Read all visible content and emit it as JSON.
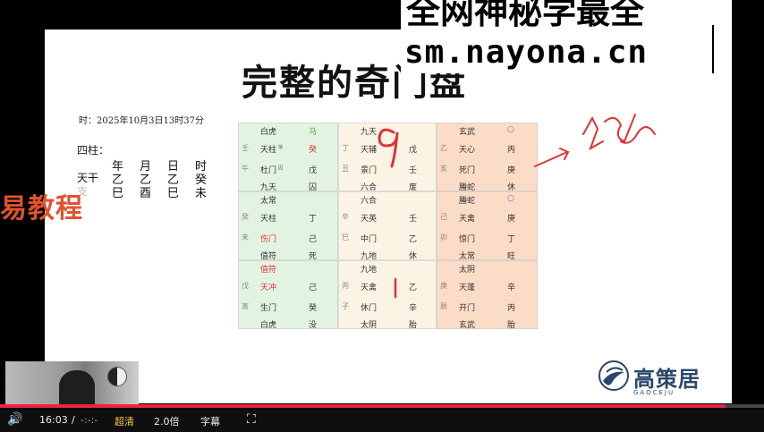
{
  "watermark": {
    "line1": "全网神秘学最全",
    "line2": "sm.nayona.cn"
  },
  "slide": {
    "title": "完整的奇门盘",
    "time_label": "时：2025年10月3日13时37分",
    "sizhu_label": "四柱：",
    "pillar_headers": [
      "年",
      "月",
      "日",
      "时"
    ],
    "tiangan_label": "天干",
    "tiangan": [
      "乙",
      "乙",
      "乙",
      "癸"
    ],
    "dizhi_label": "支",
    "dizhi": [
      "巳",
      "酉",
      "巳",
      "未"
    ]
  },
  "side_label": "易教程",
  "grid": [
    {
      "color": "green",
      "lines": [
        {
          "side": "",
          "a": "白虎",
          "b": "马",
          "b_color": "green"
        },
        {
          "side": "壬",
          "a": "天柱",
          "a_sub": "惊",
          "b": "癸",
          "b_color": "red"
        },
        {
          "side": "午",
          "a": "杜门",
          "a_sub": "囚",
          "b": "戊"
        },
        {
          "side": "",
          "a": "九天",
          "b": "囚"
        }
      ]
    },
    {
      "color": "cream",
      "lines": [
        {
          "side": "",
          "a": "九天"
        },
        {
          "side": "丁",
          "a": "天辅",
          "b": "戊"
        },
        {
          "side": "丑",
          "a": "景门",
          "b": "壬"
        },
        {
          "side": "",
          "a": "六合",
          "b": "废"
        }
      ]
    },
    {
      "color": "orange",
      "lines": [
        {
          "side": "",
          "a": "玄武",
          "b": "○",
          "b_color": "purple"
        },
        {
          "side": "乙",
          "a": "天心",
          "b": "丙"
        },
        {
          "side": "亥",
          "a": "死门",
          "b": "庚"
        },
        {
          "side": "",
          "a": "螣蛇",
          "b": "休"
        }
      ]
    },
    {
      "color": "green",
      "lines": [
        {
          "side": "",
          "a": "太常"
        },
        {
          "side": "癸",
          "a": "天柱",
          "b": "丁"
        },
        {
          "side": "未",
          "a": "伤门",
          "a_color": "red",
          "b": "己"
        },
        {
          "side": "",
          "a": "值符",
          "b": "死"
        }
      ]
    },
    {
      "color": "cream",
      "lines": [
        {
          "side": "",
          "a": "六合"
        },
        {
          "side": "辛",
          "a": "天英",
          "b": "壬"
        },
        {
          "side": "巳",
          "a": "中门",
          "b": "乙"
        },
        {
          "side": "",
          "a": "九地",
          "b": "休"
        }
      ]
    },
    {
      "color": "orange",
      "lines": [
        {
          "side": "",
          "a": "螣蛇",
          "b": "○",
          "b_color": "purple"
        },
        {
          "side": "己",
          "a": "天禽",
          "b": "庚"
        },
        {
          "side": "卯",
          "a": "惊门",
          "b": "丁"
        },
        {
          "side": "",
          "a": "太常",
          "b": "旺"
        }
      ]
    },
    {
      "color": "green",
      "lines": [
        {
          "side": "",
          "a": "值符",
          "a_color": "red"
        },
        {
          "side": "戊",
          "a": "天冲",
          "a_color": "red",
          "b": "己"
        },
        {
          "side": "寅",
          "a": "生门",
          "b": "癸"
        },
        {
          "side": "",
          "a": "白虎",
          "b": "没"
        }
      ]
    },
    {
      "color": "cream",
      "lines": [
        {
          "side": "",
          "a": "九地"
        },
        {
          "side": "丙",
          "a": "天禽",
          "b": "乙"
        },
        {
          "side": "子",
          "a": "休门",
          "b": "辛"
        },
        {
          "side": "",
          "a": "太阴",
          "b": "胎"
        }
      ]
    },
    {
      "color": "orange",
      "lines": [
        {
          "side": "",
          "a": "太阴"
        },
        {
          "side": "庚",
          "a": "天蓬",
          "b": "辛"
        },
        {
          "side": "辰",
          "a": "开门",
          "b": "丙"
        },
        {
          "side": "",
          "a": "玄武",
          "b": "胎"
        }
      ]
    }
  ],
  "logo": {
    "text": "高策居",
    "sub": "GAOCEJU"
  },
  "player": {
    "current_time": "16:03",
    "separator": "/",
    "total_time": "-:-:-",
    "quality": "超清",
    "speed": "2.0倍",
    "subtitles": "字幕",
    "progress": 0.95
  }
}
